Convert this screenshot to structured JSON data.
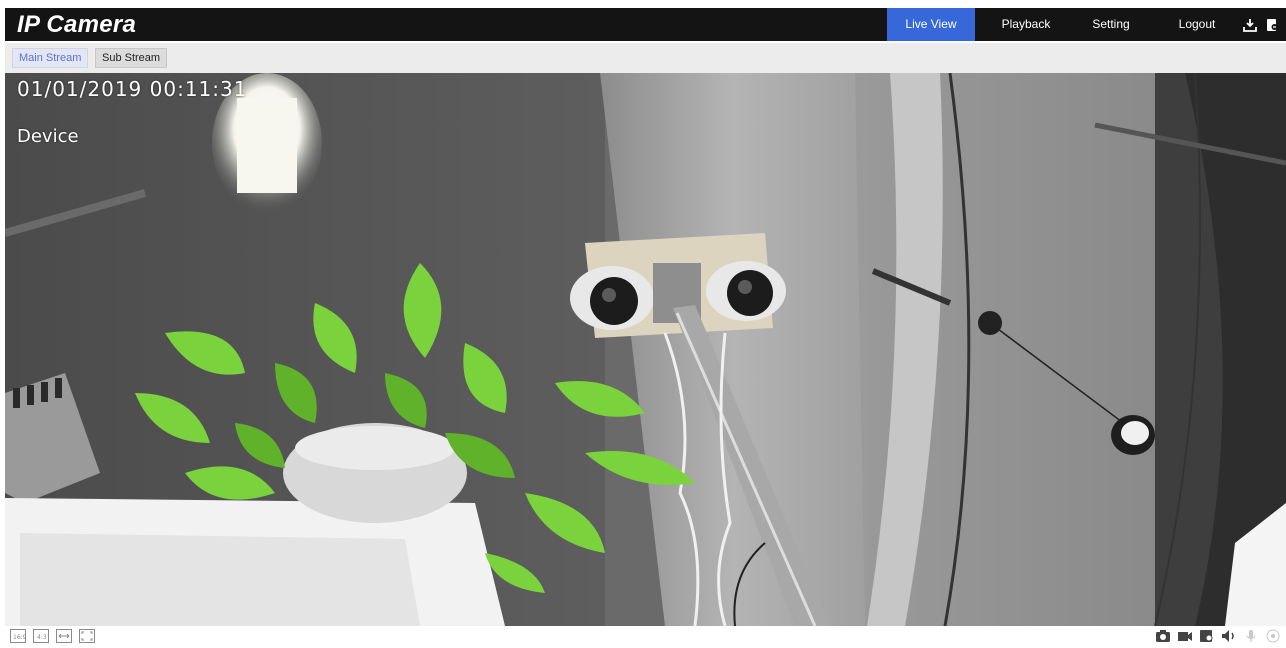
{
  "app": {
    "title": "IP Camera"
  },
  "nav": {
    "items": [
      {
        "label": "Live View",
        "active": true
      },
      {
        "label": "Playback",
        "active": false
      },
      {
        "label": "Setting",
        "active": false
      },
      {
        "label": "Logout",
        "active": false
      }
    ],
    "icons": [
      "download-icon",
      "export-icon"
    ]
  },
  "streams": {
    "main_label": "Main Stream",
    "sub_label": "Sub Stream",
    "selected": "Main Stream"
  },
  "video": {
    "osd_time": "01/01/2019 00:11:31",
    "osd_device": "Device"
  },
  "toolbar": {
    "left_icons": [
      "original-size-icon",
      "aspect-4-3-icon",
      "stretch-icon",
      "fullscreen-icon"
    ],
    "right_icons": [
      "snapshot-icon",
      "record-icon",
      "zoom-icon",
      "audio-icon",
      "microphone-icon",
      "ptz-icon"
    ]
  },
  "colors": {
    "header_bg": "#141414",
    "active_tab": "#3668d9",
    "stream_bar": "#ececec"
  }
}
